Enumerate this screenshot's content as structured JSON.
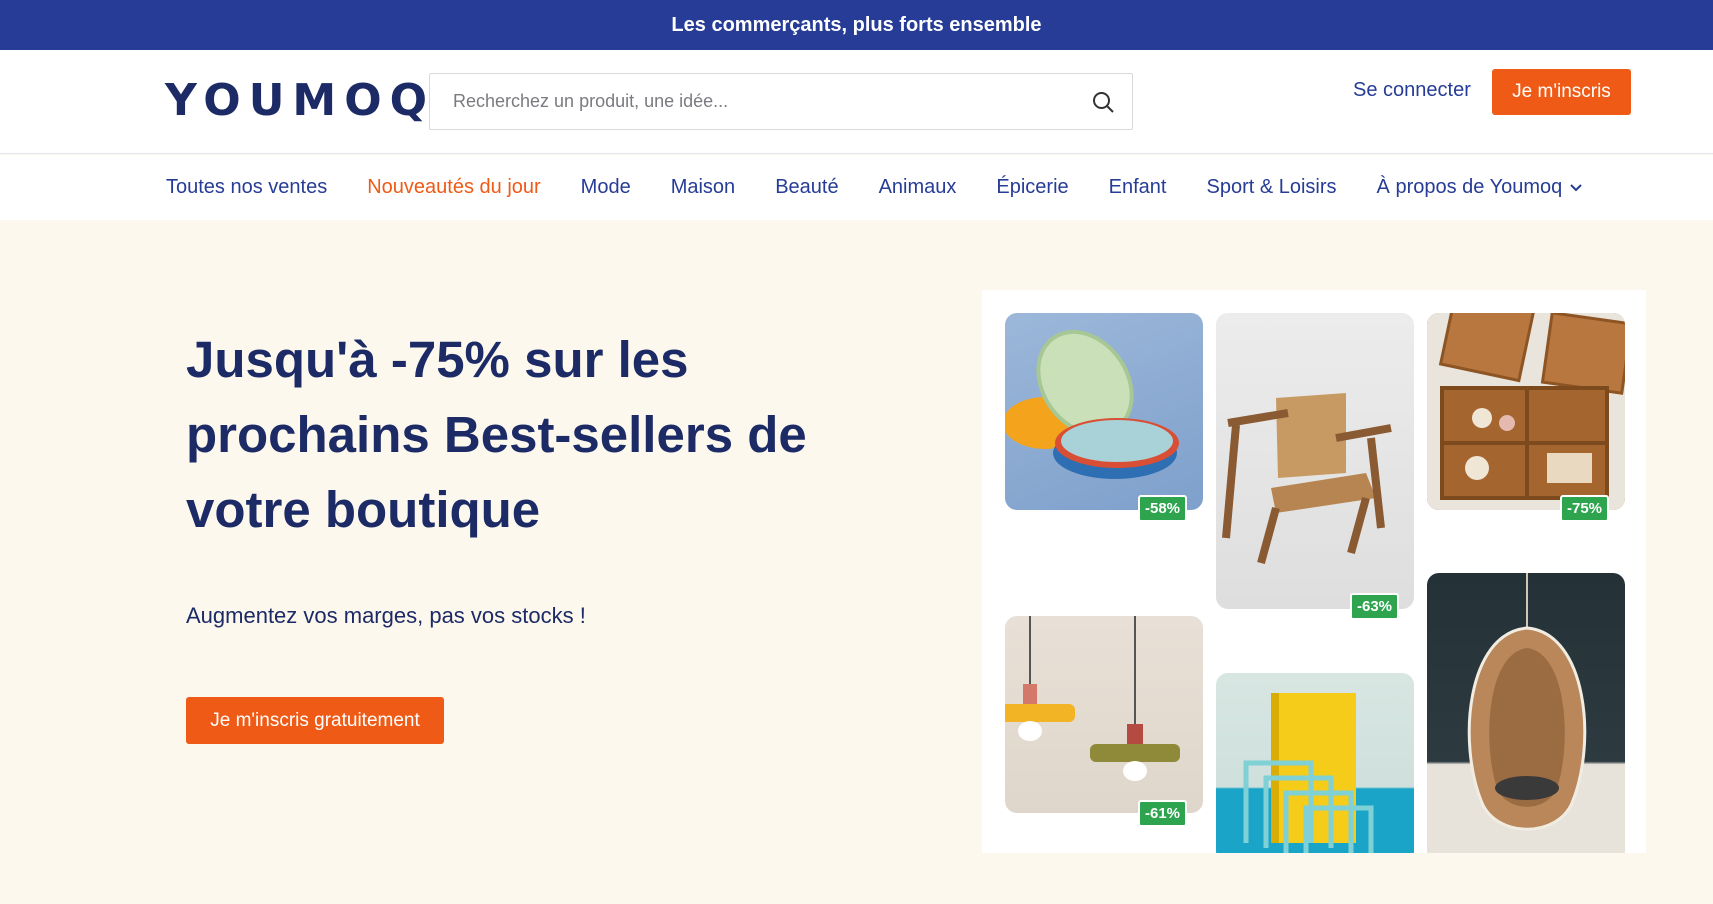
{
  "announcement": "Les commerçants, plus forts ensemble",
  "header": {
    "logo": "YOUMOQ",
    "search_placeholder": "Recherchez un produit, une idée...",
    "login_label": "Se connecter",
    "signup_label": "Je m'inscris"
  },
  "nav": {
    "items": [
      {
        "label": "Toutes nos ventes"
      },
      {
        "label": "Nouveautés du jour",
        "active": true
      },
      {
        "label": "Mode"
      },
      {
        "label": "Maison"
      },
      {
        "label": "Beauté"
      },
      {
        "label": "Animaux"
      },
      {
        "label": "Épicerie"
      },
      {
        "label": "Enfant"
      },
      {
        "label": "Sport & Loisirs"
      },
      {
        "label": "À propos de Youmoq",
        "icon": "chevron-down-icon"
      }
    ]
  },
  "hero": {
    "title_line1": "Jusqu'à -75% sur les",
    "title_line2": "prochains Best-sellers de",
    "title_line3": "votre boutique",
    "subtitle": "Augmentez vos marges, pas vos stocks !",
    "cta_label": "Je m'inscris gratuitement"
  },
  "products": [
    {
      "name": "plates",
      "discount": "-58%"
    },
    {
      "name": "chair",
      "discount": "-63%"
    },
    {
      "name": "baskets",
      "discount": "-75%"
    },
    {
      "name": "lamps",
      "discount": "-61%"
    },
    {
      "name": "file-holder"
    },
    {
      "name": "hanging-chair"
    }
  ],
  "colors": {
    "brand_blue": "#263c96",
    "navy_text": "#1c2a66",
    "accent_orange": "#ef5a16",
    "hero_bg": "#fdf8ee",
    "discount_green": "#2ea44f"
  }
}
